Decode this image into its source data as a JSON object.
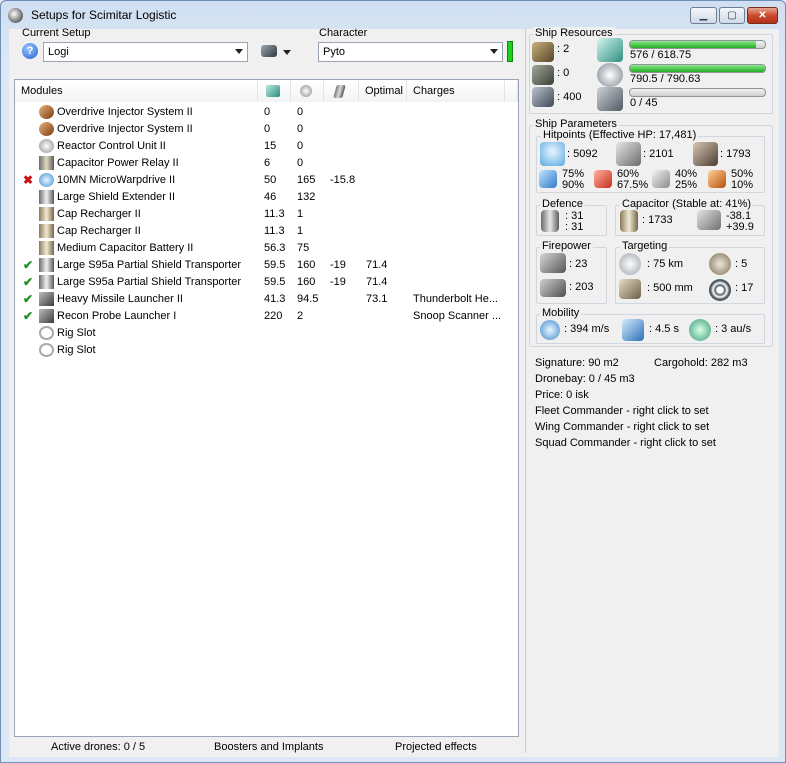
{
  "window": {
    "title": "Setups for Scimitar Logistic"
  },
  "setup": {
    "label": "Current Setup",
    "value": "Logi"
  },
  "character": {
    "label": "Character",
    "value": "Pyto"
  },
  "modules": {
    "headers": {
      "name": "Modules",
      "optimal": "Optimal",
      "charges": "Charges"
    },
    "rows": [
      {
        "state": "",
        "name": "Overdrive Injector System II",
        "cpu": "0",
        "pg": "0",
        "cap": "",
        "optimal": "",
        "charges": ""
      },
      {
        "state": "",
        "name": "Overdrive Injector System II",
        "cpu": "0",
        "pg": "0",
        "cap": "",
        "optimal": "",
        "charges": ""
      },
      {
        "state": "",
        "name": "Reactor Control Unit II",
        "cpu": "15",
        "pg": "0",
        "cap": "",
        "optimal": "",
        "charges": ""
      },
      {
        "state": "",
        "name": "Capacitor Power Relay II",
        "cpu": "6",
        "pg": "0",
        "cap": "",
        "optimal": "",
        "charges": ""
      },
      {
        "state": "✖",
        "name": "10MN MicroWarpdrive II",
        "cpu": "50",
        "pg": "165",
        "cap": "-15.8",
        "optimal": "",
        "charges": ""
      },
      {
        "state": "",
        "name": "Large Shield Extender II",
        "cpu": "46",
        "pg": "132",
        "cap": "",
        "optimal": "",
        "charges": ""
      },
      {
        "state": "",
        "name": "Cap Recharger II",
        "cpu": "11.3",
        "pg": "1",
        "cap": "",
        "optimal": "",
        "charges": ""
      },
      {
        "state": "",
        "name": "Cap Recharger II",
        "cpu": "11.3",
        "pg": "1",
        "cap": "",
        "optimal": "",
        "charges": ""
      },
      {
        "state": "",
        "name": "Medium Capacitor Battery II",
        "cpu": "56.3",
        "pg": "75",
        "cap": "",
        "optimal": "",
        "charges": ""
      },
      {
        "state": "✔",
        "name": "Large S95a Partial Shield Transporter",
        "cpu": "59.5",
        "pg": "160",
        "cap": "-19",
        "optimal": "71.4",
        "charges": ""
      },
      {
        "state": "✔",
        "name": "Large S95a Partial Shield Transporter",
        "cpu": "59.5",
        "pg": "160",
        "cap": "-19",
        "optimal": "71.4",
        "charges": ""
      },
      {
        "state": "✔",
        "name": "Heavy Missile Launcher II",
        "cpu": "41.3",
        "pg": "94.5",
        "cap": "",
        "optimal": "73.1",
        "charges": "Thunderbolt He..."
      },
      {
        "state": "✔",
        "name": "Recon Probe Launcher I",
        "cpu": "220",
        "pg": "2",
        "cap": "",
        "optimal": "",
        "charges": "Snoop Scanner ..."
      },
      {
        "state": "",
        "name": "Rig Slot",
        "cpu": "",
        "pg": "",
        "cap": "",
        "optimal": "",
        "charges": ""
      },
      {
        "state": "",
        "name": "Rig Slot",
        "cpu": "",
        "pg": "",
        "cap": "",
        "optimal": "",
        "charges": ""
      }
    ]
  },
  "status_bar": {
    "drones": "Active drones: 0 / 5",
    "boosters": "Boosters and Implants",
    "projected": "Projected effects"
  },
  "resources": {
    "title": "Ship Resources",
    "turret_hardpoints": ": 2",
    "launcher_hardpoints": ": 0",
    "calibration": ": 400",
    "cpu": {
      "text": "576 / 618.75",
      "fraction": 0.931
    },
    "powergrid": {
      "text": "790.5 / 790.63",
      "fraction": 1.0
    },
    "dronebay_bandwidth": {
      "text": "0 / 45",
      "fraction": 0.0
    }
  },
  "params": {
    "title": "Ship Parameters",
    "hitpoints": {
      "title": "Hitpoints (Effective HP: 17,481)",
      "shield": ": 5092",
      "armor": ": 2101",
      "structure": ": 1793",
      "res_em": [
        "75%",
        "90%"
      ],
      "res_thermal": [
        "60%",
        "67.5%"
      ],
      "res_kinetic": [
        "40%",
        "25%"
      ],
      "res_explosive": [
        "50%",
        "10%"
      ]
    },
    "defence": {
      "title": "Defence",
      "v1": ": 31",
      "v2": ": 31"
    },
    "capacitor": {
      "title": "Capacitor (Stable at: 41%)",
      "amount": ": 1733",
      "delta": [
        "-38.1",
        "+39.9"
      ]
    },
    "firepower": {
      "title": "Firepower",
      "turret": ": 23",
      "missile": ": 203"
    },
    "targeting": {
      "title": "Targeting",
      "range": ": 75 km",
      "targets": ": 5",
      "scanres": ": 500 mm",
      "sensor": ": 17"
    },
    "mobility": {
      "title": "Mobility",
      "speed": ": 394 m/s",
      "align": ": 4.5 s",
      "warp": ": 3 au/s"
    }
  },
  "info": {
    "signature": "Signature: 90 m2",
    "cargohold": "Cargohold: 282 m3",
    "dronebay": "Dronebay: 0 / 45 m3",
    "price": "Price: 0 isk",
    "fleet": "Fleet Commander - right click to set",
    "wing": "Wing Commander - right click to set",
    "squad": "Squad Commander - right click to set"
  },
  "colors": {
    "accent_green": "#1fae1f",
    "error_red": "#c81414",
    "title_close": "#c94a2c"
  }
}
